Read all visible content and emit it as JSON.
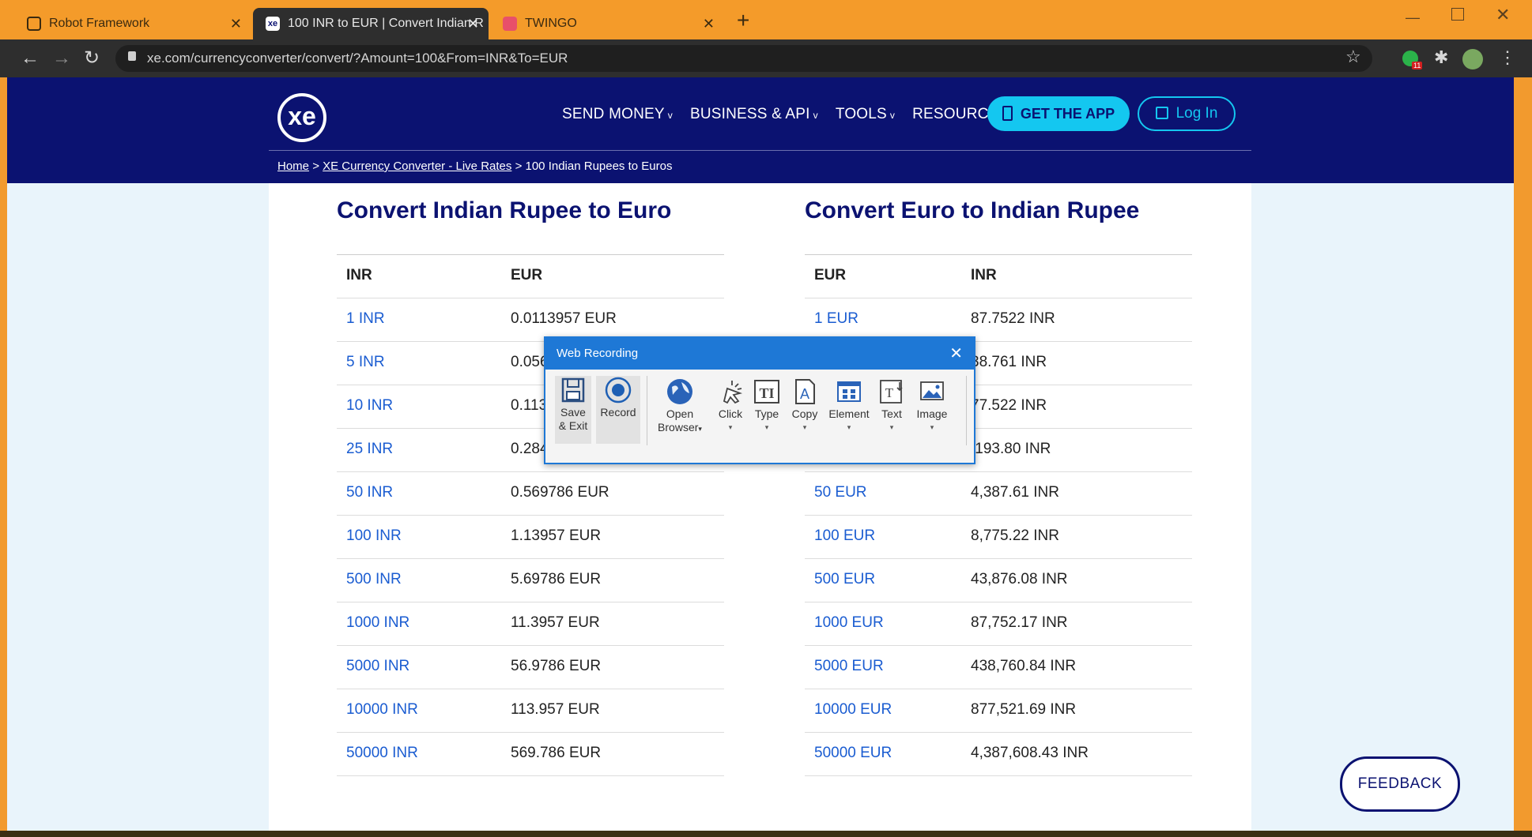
{
  "browser": {
    "tabs": [
      {
        "label": "Robot Framework",
        "active": false
      },
      {
        "label": "100 INR to EUR | Convert Indian R",
        "active": true
      },
      {
        "label": "TWINGO",
        "active": false
      }
    ],
    "url": "xe.com/currencyconverter/convert/?Amount=100&From=INR&To=EUR",
    "extension_badge": "11"
  },
  "site": {
    "logo": "xe",
    "nav": [
      "SEND MONEY",
      "BUSINESS & API",
      "TOOLS",
      "RESOURCES"
    ],
    "get_app": "GET THE APP",
    "login": "Log In",
    "breadcrumb": {
      "home": "Home",
      "converter": "XE Currency Converter - Live Rates",
      "separator": ">",
      "current": "100 Indian Rupees to Euros"
    },
    "left_title": "Convert Indian Rupee to Euro",
    "right_title": "Convert Euro to Indian Rupee",
    "left_headers": [
      "INR",
      "EUR"
    ],
    "right_headers": [
      "EUR",
      "INR"
    ],
    "left_rows": [
      [
        "1 INR",
        "0.0113957 EUR"
      ],
      [
        "5 INR",
        "0.056"
      ],
      [
        "10 INR",
        "0.113"
      ],
      [
        "25 INR",
        "0.284"
      ],
      [
        "50 INR",
        "0.569786 EUR"
      ],
      [
        "100 INR",
        "1.13957 EUR"
      ],
      [
        "500 INR",
        "5.69786 EUR"
      ],
      [
        "1000 INR",
        "11.3957 EUR"
      ],
      [
        "5000 INR",
        "56.9786 EUR"
      ],
      [
        "10000 INR",
        "113.957 EUR"
      ],
      [
        "50000 INR",
        "569.786 EUR"
      ]
    ],
    "right_rows": [
      [
        "1 EUR",
        "87.7522 INR"
      ],
      [
        "",
        "38.761 INR"
      ],
      [
        "",
        "77.522 INR"
      ],
      [
        "",
        ",193.80 INR"
      ],
      [
        "50 EUR",
        "4,387.61 INR"
      ],
      [
        "100 EUR",
        "8,775.22 INR"
      ],
      [
        "500 EUR",
        "43,876.08 INR"
      ],
      [
        "1000 EUR",
        "87,752.17 INR"
      ],
      [
        "5000 EUR",
        "438,760.84 INR"
      ],
      [
        "10000 EUR",
        "877,521.69 INR"
      ],
      [
        "50000 EUR",
        "4,387,608.43 INR"
      ]
    ],
    "feedback": "FEEDBACK"
  },
  "web_recording": {
    "title": "Web Recording",
    "buttons": [
      {
        "line1": "Save",
        "line2": "& Exit"
      },
      {
        "line1": "Record",
        "line2": ""
      },
      {
        "line1": "Open",
        "line2": "Browser"
      },
      {
        "line1": "Click",
        "line2": ""
      },
      {
        "line1": "Type",
        "line2": ""
      },
      {
        "line1": "Copy",
        "line2": ""
      },
      {
        "line1": "Element",
        "line2": ""
      },
      {
        "line1": "Text",
        "line2": ""
      },
      {
        "line1": "Image",
        "line2": ""
      }
    ]
  },
  "colors": {
    "brand_navy": "#0b1271",
    "accent_cyan": "#14c7f0",
    "link_blue": "#1a5cd1",
    "dialog_blue": "#1e78d6",
    "tab_orange": "#f49b2a"
  }
}
